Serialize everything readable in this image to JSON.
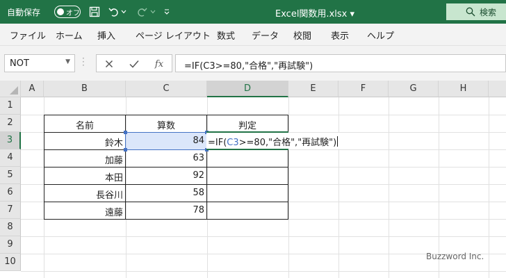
{
  "titlebar": {
    "autosave_label": "自動保存",
    "toggle_text": "オフ",
    "document_title": "Excel関数用.xlsx ▾",
    "search_label": "検索"
  },
  "ribbon": {
    "tabs": [
      "ファイル",
      "ホーム",
      "挿入",
      "ページ レイアウト",
      "数式",
      "データ",
      "校閲",
      "表示",
      "ヘルプ"
    ]
  },
  "formula_bar": {
    "name_box": "NOT",
    "fx_label": "fx",
    "formula": "=IF(C3>=80,\"合格\",\"再試験\")"
  },
  "grid": {
    "columns": [
      "A",
      "B",
      "C",
      "D",
      "E",
      "F",
      "G",
      "H"
    ],
    "rows": [
      "1",
      "2",
      "3",
      "4",
      "5",
      "6",
      "7",
      "8",
      "9",
      "10"
    ],
    "selected_column": "D",
    "selected_row": "3"
  },
  "table": {
    "headers": [
      "名前",
      "算数",
      "判定"
    ],
    "rows": [
      {
        "name": "鈴木",
        "score": "84"
      },
      {
        "name": "加藤",
        "score": "63"
      },
      {
        "name": "本田",
        "score": "92"
      },
      {
        "name": "長谷川",
        "score": "58"
      },
      {
        "name": "遠藤",
        "score": "78"
      }
    ]
  },
  "edit_cell": {
    "prefix": "=IF(",
    "ref": "C3",
    "suffix": ">=80,\"合格\",\"再試験\")"
  },
  "watermark": "Buzzword Inc.",
  "colors": {
    "excel_green": "#217346",
    "ref_blue": "#4472c4"
  }
}
